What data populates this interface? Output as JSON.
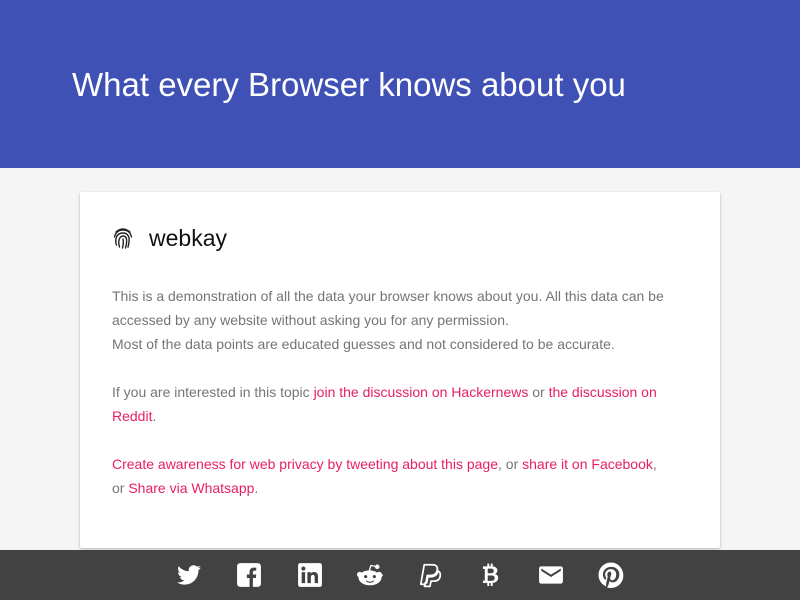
{
  "header": {
    "title": "What every Browser knows about you"
  },
  "card": {
    "brand_name": "webkay",
    "intro_line1": "This is a demonstration of all the data your browser knows about you. All this data can be accessed by any website without asking you for any permission.",
    "intro_line2": "Most of the data points are educated guesses and not considered to be accurate.",
    "discussion_prefix": "If you are interested in this topic ",
    "hackernews_link": "join the discussion on Hackernews",
    "discussion_or": " or ",
    "reddit_link": "the discussion on Reddit",
    "discussion_suffix": ".",
    "tweet_link": "Create awareness for web privacy by tweeting about this page",
    "share_sep1": ", or ",
    "facebook_link": "share it on Facebook",
    "share_sep2": ", or ",
    "whatsapp_link": "Share via Whatsapp",
    "share_suffix": "."
  },
  "footer": {
    "icons": [
      "twitter-icon",
      "facebook-icon",
      "linkedin-icon",
      "reddit-icon",
      "paypal-icon",
      "bitcoin-icon",
      "email-icon",
      "pinterest-icon"
    ]
  },
  "colors": {
    "header_bg": "#3f51b5",
    "link": "#e91e63",
    "body_text": "#757575",
    "footer_bg": "#424242",
    "icon": "#ffffff"
  }
}
